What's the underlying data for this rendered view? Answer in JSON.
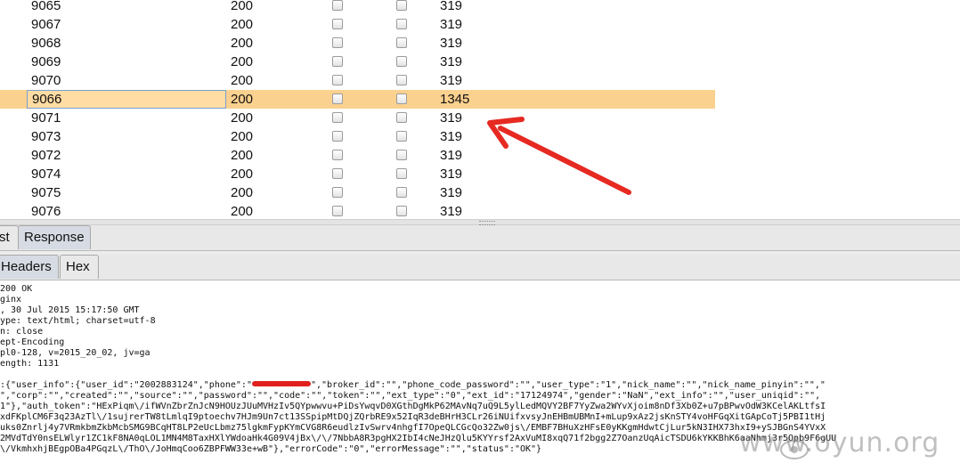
{
  "table": {
    "rows": [
      {
        "request": "9065",
        "status": "200",
        "length": "319"
      },
      {
        "request": "9067",
        "status": "200",
        "length": "319"
      },
      {
        "request": "9068",
        "status": "200",
        "length": "319"
      },
      {
        "request": "9069",
        "status": "200",
        "length": "319"
      },
      {
        "request": "9070",
        "status": "200",
        "length": "319"
      },
      {
        "request": "9066",
        "status": "200",
        "length": "1345"
      },
      {
        "request": "9071",
        "status": "200",
        "length": "319"
      },
      {
        "request": "9073",
        "status": "200",
        "length": "319"
      },
      {
        "request": "9072",
        "status": "200",
        "length": "319"
      },
      {
        "request": "9074",
        "status": "200",
        "length": "319"
      },
      {
        "request": "9075",
        "status": "200",
        "length": "319"
      },
      {
        "request": "9076",
        "status": "200",
        "length": "319"
      }
    ],
    "selected_row_color": "#fbd18f"
  },
  "tabs": {
    "request_label": "st",
    "response_label": "Response",
    "headers_label": "Headers",
    "hex_label": "Hex"
  },
  "response": {
    "lines": [
      "200 OK",
      "ginx",
      ", 30 Jul 2015 15:17:50 GMT",
      "ype: text/html; charset=utf-8",
      "n: close",
      "ept-Encoding",
      "pl0-128, v=2015_20_02, jv=ga",
      "ength: 1131",
      "",
      ":{\"user_info\":{\"user_id\":\"2002883124\",\"phone\":\"",
      "\",\"corp\":\"\",\"created\":\"\",\"source\":\"\",\"password\":\"\",\"code\":\"\",\"token\":\"\",\"ext_type\":\"0\",\"ext_id\":\"17124974\",\"gender\":\"NaN\",\"ext_info\":\"\",\"user_uniqid\":\"\",",
      "1\"},\"auth_token\":\"HExPiqm\\/ifWVnZbrZnJcN9HOUzJUuMVHzIv5QYpwwvu+PiDsYwqvD0XGthDgMkP62MAvNq7uQ9L5ylLedMQVY2BF7YyZwa2WYvXjoim8nDf3Xb0Z+u7pBPwvOdW3KCelAKLtfsI",
      "xdFKplCM6F3q23AzTl\\/1sujrerTW8tLmlqI9ptoechv7HJm9Un7ct13SSpipMtDQjZQrbRE9x52IqR3deBHrH3CLr26iNUifxvsyJnEHBmUBMnI+mLup9xAz2jsKnSTY4voHFGqXitGApCoTj5PBI1tHj",
      "uks0Znrlj4y7VRmkbmZkbMcbSMG9BCqHT8LP2eUcLbmz75lgkmFypKYmCVG8R6eudlzIvSwrv4nhgfI7OpeQLCGcQo32Zw0js\\/EMBF7BHuXzHFsE0yKKgmHdwtCjLur5kN3IHX73hxI9+ySJBGnS4YVxX",
      "2MVdTdY0nsELWlyr1ZC1kF8NA0qLOL1MN4M8TaxHXlYWdoaHk4G09V4jBx\\/\\/7NbbA8R3pgHX2IbI4cNeJHzQlu5KYYrsf2AxVuMI8xqQ71f2bgg2Z7OanzUqAicTSDU6kYKKBhK6aaNhmj3r5Opb9F6gUU",
      "\\/VkmhxhjBEgpOBa4PGqzL\\/ThO\\/JoHmqCoo6ZBPFWW33e+wB\"},\"errorCode\":\"0\",\"errorMessage\":\"\",\"status\":\"OK\"}"
    ],
    "phone_after_redaction": "\",\"broker_id\":\"\",\"phone_code_password\":\"\",\"user_type\":\"1\",\"nick_name\":\"\",\"nick_name_pinyin\":\"\",\""
  },
  "annotation": {
    "arrow_color": "#e62a22"
  },
  "watermark": {
    "text": "www.oyun.org"
  }
}
